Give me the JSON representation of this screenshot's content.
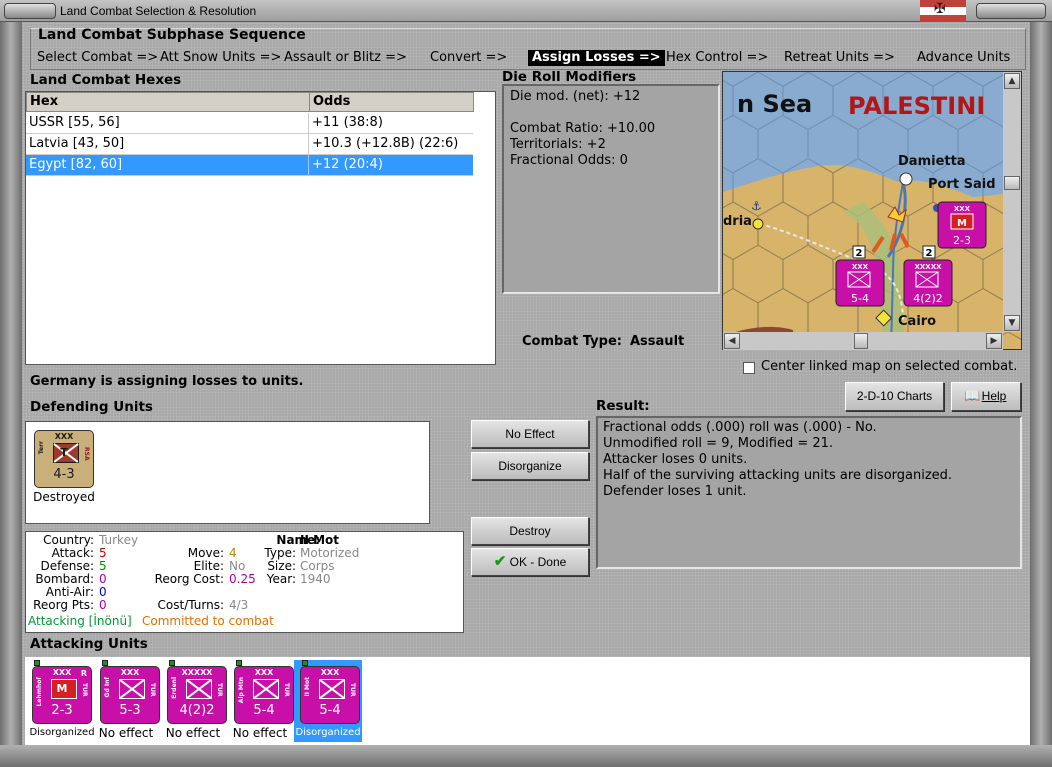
{
  "window": {
    "title": "Land Combat Selection & Resolution"
  },
  "subphase": {
    "title": "Land Combat Subphase Sequence",
    "items": [
      {
        "label": "Select Combat =>",
        "active": false
      },
      {
        "label": "Att Snow Units =>",
        "active": false
      },
      {
        "label": "Assault or Blitz =>",
        "active": false
      },
      {
        "label": "Convert =>",
        "active": false
      },
      {
        "label": "Assign Losses =>",
        "active": true
      },
      {
        "label": "Hex Control =>",
        "active": false
      },
      {
        "label": "Retreat Units =>",
        "active": false
      },
      {
        "label": "Advance Units",
        "active": false
      }
    ]
  },
  "hexes": {
    "title": "Land Combat Hexes",
    "columns": [
      "Hex",
      "Odds"
    ],
    "rows": [
      {
        "hex": "USSR [55, 56]",
        "odds": "+11 (38:8)",
        "selected": false
      },
      {
        "hex": "Latvia [43, 50]",
        "odds": "+10.3 (+12.8B) (22:6)",
        "selected": false
      },
      {
        "hex": "Egypt [82, 60]",
        "odds": "+12 (20:4)",
        "selected": true
      }
    ]
  },
  "die_roll": {
    "title": "Die Roll Modifiers",
    "lines": [
      "Die mod. (net): +12",
      "",
      "Combat Ratio: +10.00",
      "Territorials: +2",
      "Fractional Odds: 0"
    ]
  },
  "combat_type": {
    "label": "Combat Type:",
    "value": "Assault"
  },
  "map": {
    "sea_label": "n Sea",
    "region_label": "PALESTINI",
    "cities": [
      "Damietta",
      "Port Said",
      "dria",
      "Cairo"
    ],
    "stack_counts": [
      "2",
      "2"
    ],
    "units": [
      {
        "size": "XXX",
        "strength": "2-3",
        "symbol": "M"
      },
      {
        "size": "XXX",
        "strength": "5-4",
        "symbol": ""
      },
      {
        "size": "XXXXX",
        "strength": "4(2)2",
        "symbol": ""
      }
    ]
  },
  "center_map_label": "Center linked map on selected combat.",
  "chart_button": "2-D-10 Charts",
  "help_button": "Help",
  "status_text": "Germany is assigning losses to units.",
  "defending": {
    "title": "Defending Units",
    "unit": {
      "size": "XXX",
      "left": "Terr",
      "right": "RSA",
      "symbol": "T",
      "strength": "4-3",
      "status": "Destroyed"
    }
  },
  "buttons": {
    "no_effect": "No Effect",
    "disorganize": "Disorganize",
    "destroy": "Destroy",
    "ok_done": "OK - Done"
  },
  "unit_info": {
    "country_label": "Country:",
    "country": "Turkey",
    "attack_label": "Attack:",
    "attack": "5",
    "defense_label": "Defense:",
    "defense": "5",
    "bombard_label": "Bombard:",
    "bombard": "0",
    "antiair_label": "Anti-Air:",
    "antiair": "0",
    "reorg_pts_label": "Reorg Pts:",
    "reorg_pts": "0",
    "name_label": "Name:",
    "name": "II Mot",
    "move_label": "Move:",
    "move": "4",
    "type_label": "Type:",
    "type": "Motorized",
    "elite_label": "Elite:",
    "elite": "No",
    "size_label": "Size:",
    "size": "Corps",
    "reorg_cost_label": "Reorg Cost:",
    "reorg_cost": "0.25",
    "year_label": "Year:",
    "year": "1940",
    "cost_turns_label": "Cost/Turns:",
    "cost_turns": "4/3",
    "attacking_text": "Attacking [İnönü]",
    "committed_text": "Committed to combat"
  },
  "result": {
    "title": "Result:",
    "lines": [
      "Fractional odds (.000) roll was (.000)  - No.",
      "Unmodified roll = 9, Modified = 21.",
      "Attacker loses 0 units.",
      "Half of the surviving attacking units are disorganized.",
      "Defender loses 1 unit."
    ]
  },
  "attacking": {
    "title": "Attacking Units",
    "units": [
      {
        "size": "XXX",
        "left": "Lehmhof",
        "right": "TUR",
        "flag": "R",
        "symbol": "M",
        "strength": "2-3",
        "status": "Disorganized",
        "selected": false
      },
      {
        "size": "XXX",
        "left": "Gd Inf",
        "right": "TUR",
        "flag": "",
        "symbol": "",
        "strength": "5-3",
        "status": "No effect",
        "selected": false
      },
      {
        "size": "XXXXX",
        "left": "Erdenl",
        "right": "TUR",
        "flag": "",
        "symbol": "",
        "strength": "4(2)2",
        "status": "No effect",
        "selected": false
      },
      {
        "size": "XXX",
        "left": "Alp Mtn",
        "right": "TUR",
        "flag": "",
        "symbol": "",
        "strength": "5-4",
        "status": "No effect",
        "selected": false
      },
      {
        "size": "XXX",
        "left": "II Mot",
        "right": "TUR",
        "flag": "",
        "symbol": "",
        "strength": "5-4",
        "status": "Disorganized",
        "selected": true
      }
    ]
  },
  "colors": {
    "selection": "#3399ff",
    "unit_turkey": "#c80fa8",
    "unit_defender": "#c9b07b",
    "attack_red": "#cc0000",
    "defense_green": "#008800",
    "info_purple": "#aa00aa",
    "info_blue": "#0000cc",
    "attacking_green": "#009933",
    "committed_orange": "#e07000"
  }
}
